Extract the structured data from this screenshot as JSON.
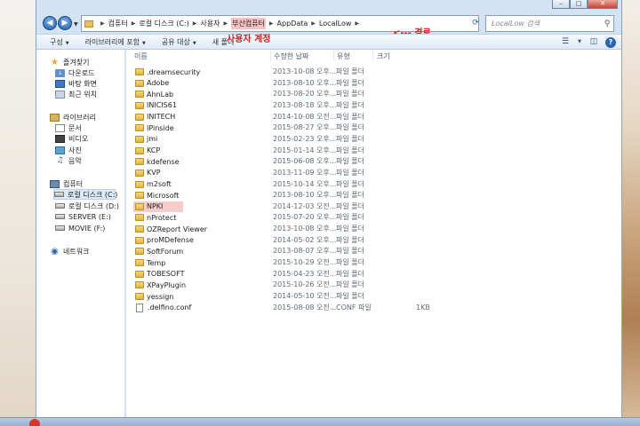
{
  "window": {
    "minimize": "–",
    "maximize": "□",
    "close": "✕"
  },
  "address": {
    "breadcrumbs": [
      "컴퓨터",
      "로컬 디스크 (C:)",
      "사용자",
      "부산컴퓨터",
      "AppData",
      "LocalLow"
    ],
    "annotation": "<--- 경로",
    "user_annotation": "사용자 계정",
    "search_placeholder": "LocalLow 검색"
  },
  "commands": {
    "organize": "구성",
    "include_library": "라이브러리에 포함",
    "share": "공유 대상",
    "new_folder": "새 폴더"
  },
  "nav": {
    "favorites": "즐겨찾기",
    "downloads": "다운로드",
    "desktop": "바탕 화면",
    "recent": "최근 위치",
    "libraries": "라이브러리",
    "documents": "문서",
    "videos": "비디오",
    "pictures": "사진",
    "music": "음악",
    "computer": "컴퓨터",
    "drive_c": "로컬 디스크 (C:)",
    "drive_d": "로컬 디스크 (D:)",
    "drive_e": "SERVER (E:)",
    "drive_f": "MOVIE (F:)",
    "network": "네트워크"
  },
  "columns": {
    "name": "이름",
    "modified": "수정한 날짜",
    "type": "유형",
    "size": "크기"
  },
  "files": [
    {
      "name": ".dreamsecurity",
      "date": "2013-10-08 오후...",
      "type": "파일 폴더",
      "size": ""
    },
    {
      "name": "Adobe",
      "date": "2013-08-10 오후...",
      "type": "파일 폴더",
      "size": ""
    },
    {
      "name": "AhnLab",
      "date": "2013-08-20 오후...",
      "type": "파일 폴더",
      "size": ""
    },
    {
      "name": "INICIS61",
      "date": "2013-08-18 오후...",
      "type": "파일 폴더",
      "size": ""
    },
    {
      "name": "INITECH",
      "date": "2014-10-08 오전...",
      "type": "파일 폴더",
      "size": ""
    },
    {
      "name": "IPinside",
      "date": "2015-08-27 오후...",
      "type": "파일 폴더",
      "size": ""
    },
    {
      "name": "jmi",
      "date": "2015-02-23 오후...",
      "type": "파일 폴더",
      "size": ""
    },
    {
      "name": "KCP",
      "date": "2015-01-14 오후...",
      "type": "파일 폴더",
      "size": ""
    },
    {
      "name": "kdefense",
      "date": "2015-06-08 오후...",
      "type": "파일 폴더",
      "size": ""
    },
    {
      "name": "KVP",
      "date": "2013-11-09 오후...",
      "type": "파일 폴더",
      "size": ""
    },
    {
      "name": "m2soft",
      "date": "2015-10-14 오후...",
      "type": "파일 폴더",
      "size": ""
    },
    {
      "name": "Microsoft",
      "date": "2013-08-10 오후...",
      "type": "파일 폴더",
      "size": ""
    },
    {
      "name": "NPKI",
      "date": "2014-12-03 오전...",
      "type": "파일 폴더",
      "size": ""
    },
    {
      "name": "nProtect",
      "date": "2015-07-20 오후...",
      "type": "파일 폴더",
      "size": ""
    },
    {
      "name": "OZReport Viewer",
      "date": "2013-10-08 오후...",
      "type": "파일 폴더",
      "size": ""
    },
    {
      "name": "proMDefense",
      "date": "2014-05-02 오후...",
      "type": "파일 폴더",
      "size": ""
    },
    {
      "name": "SoftForum",
      "date": "2013-08-07 오후...",
      "type": "파일 폴더",
      "size": ""
    },
    {
      "name": "Temp",
      "date": "2015-10-29 오전...",
      "type": "파일 폴더",
      "size": ""
    },
    {
      "name": "TOBESOFT",
      "date": "2015-04-23 오전...",
      "type": "파일 폴더",
      "size": ""
    },
    {
      "name": "XPayPlugin",
      "date": "2015-10-26 오전...",
      "type": "파일 폴더",
      "size": ""
    },
    {
      "name": "yessign",
      "date": "2014-05-10 오전...",
      "type": "파일 폴더",
      "size": ""
    },
    {
      "name": ".delfino.conf",
      "date": "2015-08-08 오전...",
      "type": "CONF 파일",
      "size": "1KB"
    }
  ],
  "highlight_color": "#f9cccc",
  "annotation_color": "#d32020"
}
